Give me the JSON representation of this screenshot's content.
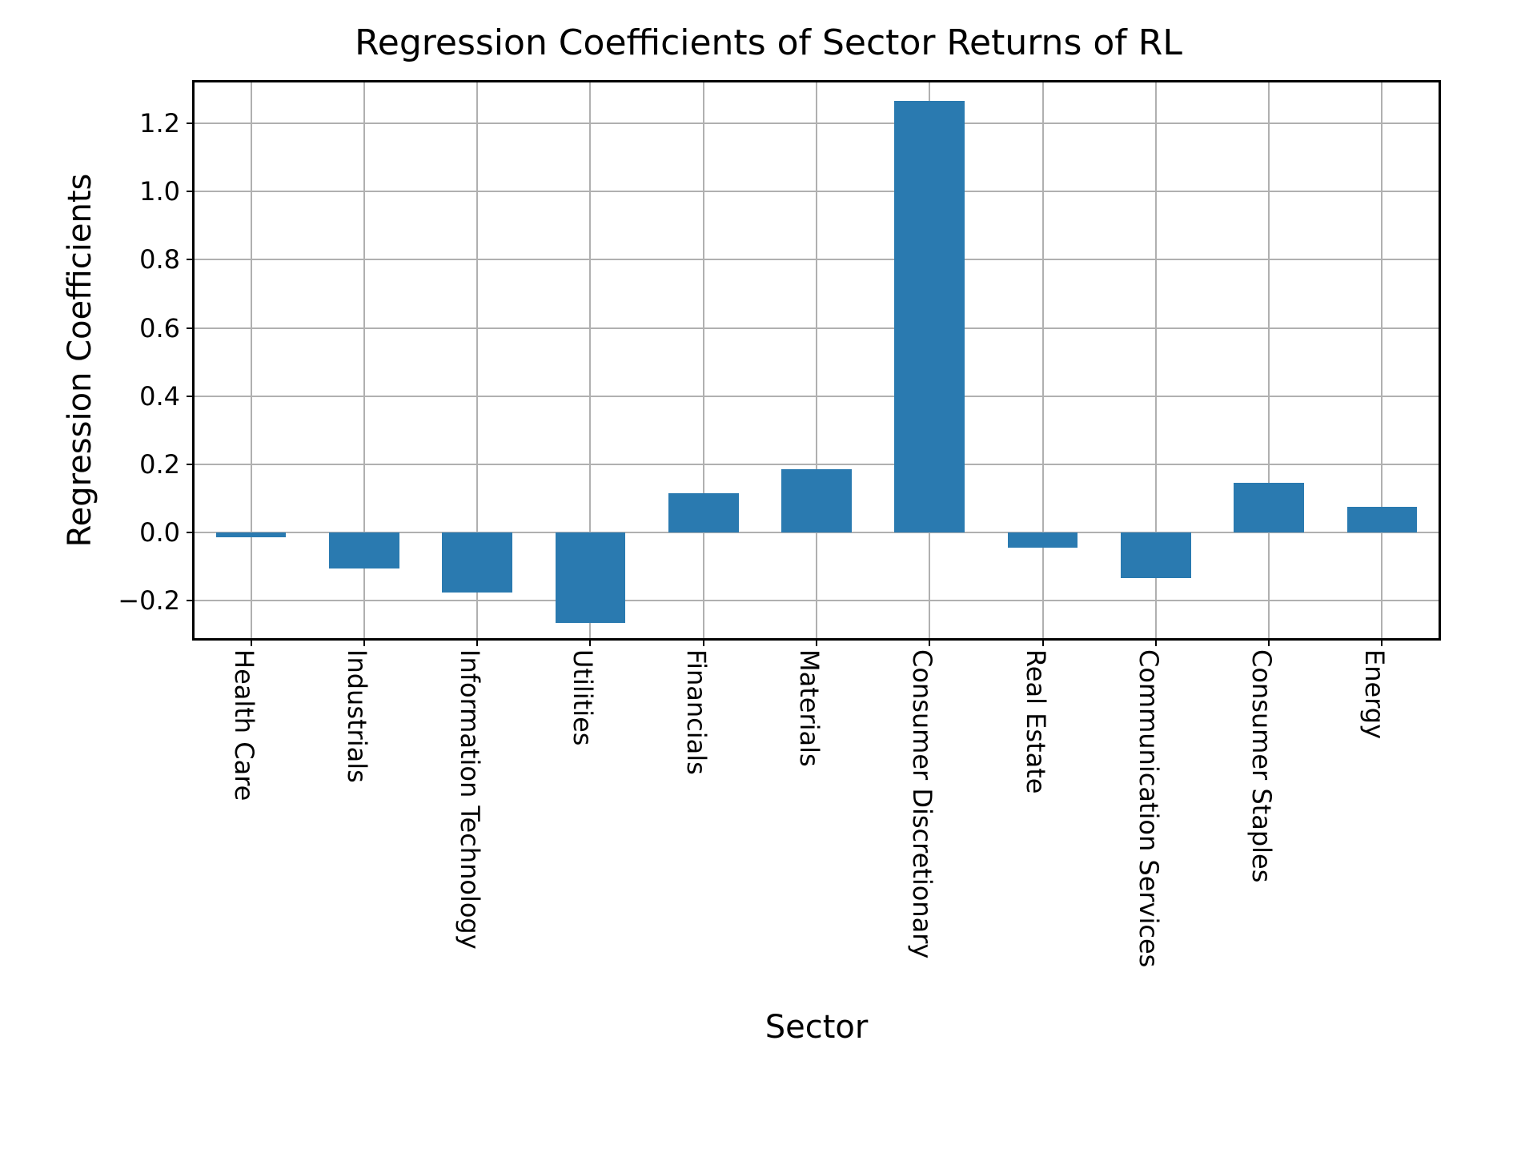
{
  "chart_data": {
    "type": "bar",
    "title": "Regression Coefficients of Sector Returns of RL",
    "xlabel": "Sector",
    "ylabel": "Regression Coefficients",
    "ylim": [
      -0.31,
      1.32
    ],
    "yticks": [
      -0.2,
      0.0,
      0.2,
      0.4,
      0.6,
      0.8,
      1.0,
      1.2
    ],
    "ytick_labels": [
      "−0.2",
      "0.0",
      "0.2",
      "0.4",
      "0.6",
      "0.8",
      "1.0",
      "1.2"
    ],
    "categories": [
      "Health Care",
      "Industrials",
      "Information Technology",
      "Utilities",
      "Financials",
      "Materials",
      "Consumer Discretionary",
      "Real Estate",
      "Communication Services",
      "Consumer Staples",
      "Energy"
    ],
    "values": [
      -0.013,
      -0.105,
      -0.175,
      -0.265,
      0.115,
      0.185,
      1.265,
      -0.045,
      -0.135,
      0.145,
      0.075
    ],
    "bar_color": "#2a7ab0"
  }
}
